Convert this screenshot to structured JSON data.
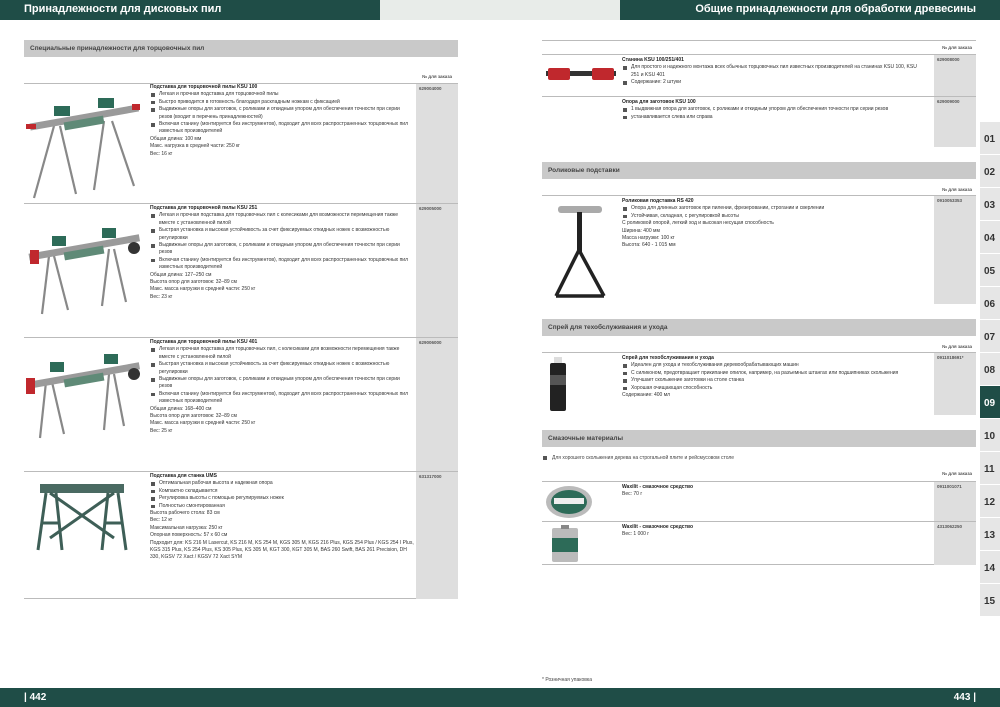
{
  "header": {
    "left_title": "Принадлежности для дисковых пил",
    "right_title": "Общие принадлежности для обработки древесины"
  },
  "footer": {
    "left_page": "| 442",
    "right_page": "443 |"
  },
  "left": {
    "section_title": "Специальные принадлежности для торцовочных пил",
    "order_label": "№ для заказа",
    "products": [
      {
        "title": "Подставка для торцовочной пилы KSU 100",
        "code": "629004000",
        "bullets": [
          "Легкая и прочная подставка для торцовочной пилы",
          "Быстро приводится в готовность благодаря раскладным ножкам с фиксацией",
          "Выдвижные опоры для заготовок, с роликами и откидным упором для обеспечения точности при серии резов (входит в перечень принадлежностей)",
          "Включая станину (монтируется без инструментов), подходит для всех распространенных торцовочных пил известных производителей"
        ],
        "specs": [
          "Общая длина: 100 мм",
          "Макс. нагрузка в средней части: 250 кг",
          "Вес: 16 кг"
        ]
      },
      {
        "title": "Подставка для торцовочной пилы KSU 251",
        "code": "629005000",
        "bullets": [
          "Легкая и прочная подставка для торцовочных пил с колесиками для возможности перемещения также вместе с установленной пилой",
          "Быстрая установка и высокая устойчивость за счет фиксируемых откидных ножек с возможностью регулировки",
          "Выдвижные опоры для заготовок, с роликами и откидным упором для обеспечения точности при серии резов",
          "Включая станину (монтируется без инструментов), подходит для всех распространенных торцовочных пил известных производителей"
        ],
        "specs": [
          "Общая длина: 127–250 см",
          "Высота опор для заготовок: 32–89 см",
          "Макс. масса нагрузки в средней части: 250 кг",
          "Вес: 23 кг"
        ]
      },
      {
        "title": "Подставка для торцовочной пилы KSU 401",
        "code": "629006000",
        "bullets": [
          "Легкая и прочная подставка для торцовочных пил, с колесиками для возможности перемещения также вместе с установленной пилой",
          "Быстрая установка и высокая устойчивость за счет фиксируемых откидных ножек с возможностью регулировки",
          "Выдвижные опоры для заготовок, с роликами и откидным упором для обеспечения точности при серии резов",
          "Включая станину (монтируется без инструментов), подходит для всех распространенных торцовочных пил известных производителей"
        ],
        "specs": [
          "Общая длина: 168–400 см",
          "Высота опор для заготовок: 32–89 см",
          "Макс. масса нагрузки в средней части: 250 кг",
          "Вес: 25 кг"
        ]
      },
      {
        "title": "Подставка для станка UMS",
        "code": "631317000",
        "bullets": [
          "Оптимальная рабочая высота и надежная опора",
          "Компактно складывается",
          "Регулировка высоты с помощью регулируемых ножек",
          "Полностью смонтированная"
        ],
        "specs": [
          "Высота рабочего стола: 83 см",
          "Вес: 12 кг",
          "Максимальная нагрузка: 250 кг",
          "Опорная поверхность: 57 x 60 см",
          "Подходит для: KS 216 M Lasercut, KS 216 M, KS 254 M, KGS 305 M, KGS 216 Plus, KGS 254 Plus / KGS 254 I Plus, KGS 315 Plus, KS 254 Plus, KS 305 Plus, KS 305 M, KGT 300, KGT 305 M, BAS 260 Swift, BAS 261 Precision, DH 330, KGSV 72 Xact / KGSV 72 Xact SYM"
        ]
      }
    ]
  },
  "right": {
    "order_label": "№ для заказа",
    "stand_products": [
      {
        "title": "Станина KSU 100/251/401",
        "code": "629008000",
        "bullets": [
          "Для простого и надежного монтажа всех обычных торцовочных пил известных производителей на станинах KSU 100, KSU 251 и KSU 401",
          "Содержание: 2 штуки"
        ],
        "specs": []
      },
      {
        "title": "Опора для заготовок KSU 100",
        "code": "629009000",
        "bullets": [
          "1 выдвижная опора для заготовок, с роликами и откидным упором для обеспечения точности при серии резов",
          "устанавливается слева или справа"
        ],
        "specs": []
      }
    ],
    "roller_section": "Роликовые подставки",
    "roller_product": {
      "title": "Роликовая подставка RS 420",
      "code": "0910053353",
      "bullets": [
        "Опора для длинных заготовок при пилении, фрезеровании, строгании и сверлении",
        "Устойчивая, складная, с регулировкой высоты"
      ],
      "specs": [
        "С роликовой опорой, легкий ход и высокая несущая способность",
        "Ширина: 400 мм",
        "Масса нагрузки: 100 кг",
        "Высота: 640 - 1 015 мм"
      ]
    },
    "spray_section": "Спрей для техобслуживания и ухода",
    "spray_product": {
      "title": "Спрей для техобслуживания и ухода",
      "code": "0911018691*",
      "bullets": [
        "Идеален для ухода и техобслуживания деревообрабатывающих машин",
        "С силиконом, предотвращает прикипание опилок, например, на разъемных штангах или подшипниках скольжения",
        "Улучшает скольжение заготовки на столе станка",
        "Хорошая очищающая способность"
      ],
      "specs": [
        "Содержание: 400 мл"
      ]
    },
    "lube_section": "Смазочные материалы",
    "lube_note": "Для хорошего скольжения дерева на строгальной плите и рейсмусовом столе",
    "lube_products": [
      {
        "title": "Waxilit - смазочное средство",
        "code": "0911001071",
        "specs": [
          "Вес: 70 г"
        ]
      },
      {
        "title": "Waxilit - смазочное средство",
        "code": "4313062250",
        "specs": [
          "Вес: 1 000 г"
        ]
      }
    ],
    "footnote": "* Розничная упаковка"
  },
  "tabs": [
    "01",
    "02",
    "03",
    "04",
    "05",
    "06",
    "07",
    "08",
    "09",
    "10",
    "11",
    "12",
    "13",
    "14",
    "15"
  ],
  "active_tab": "09",
  "colors": {
    "brand": "#1f4d47",
    "band": "#c9c9c9",
    "code_cell": "#dedede",
    "leg_red": "#c0282d",
    "leg_green": "#2d6b58"
  }
}
